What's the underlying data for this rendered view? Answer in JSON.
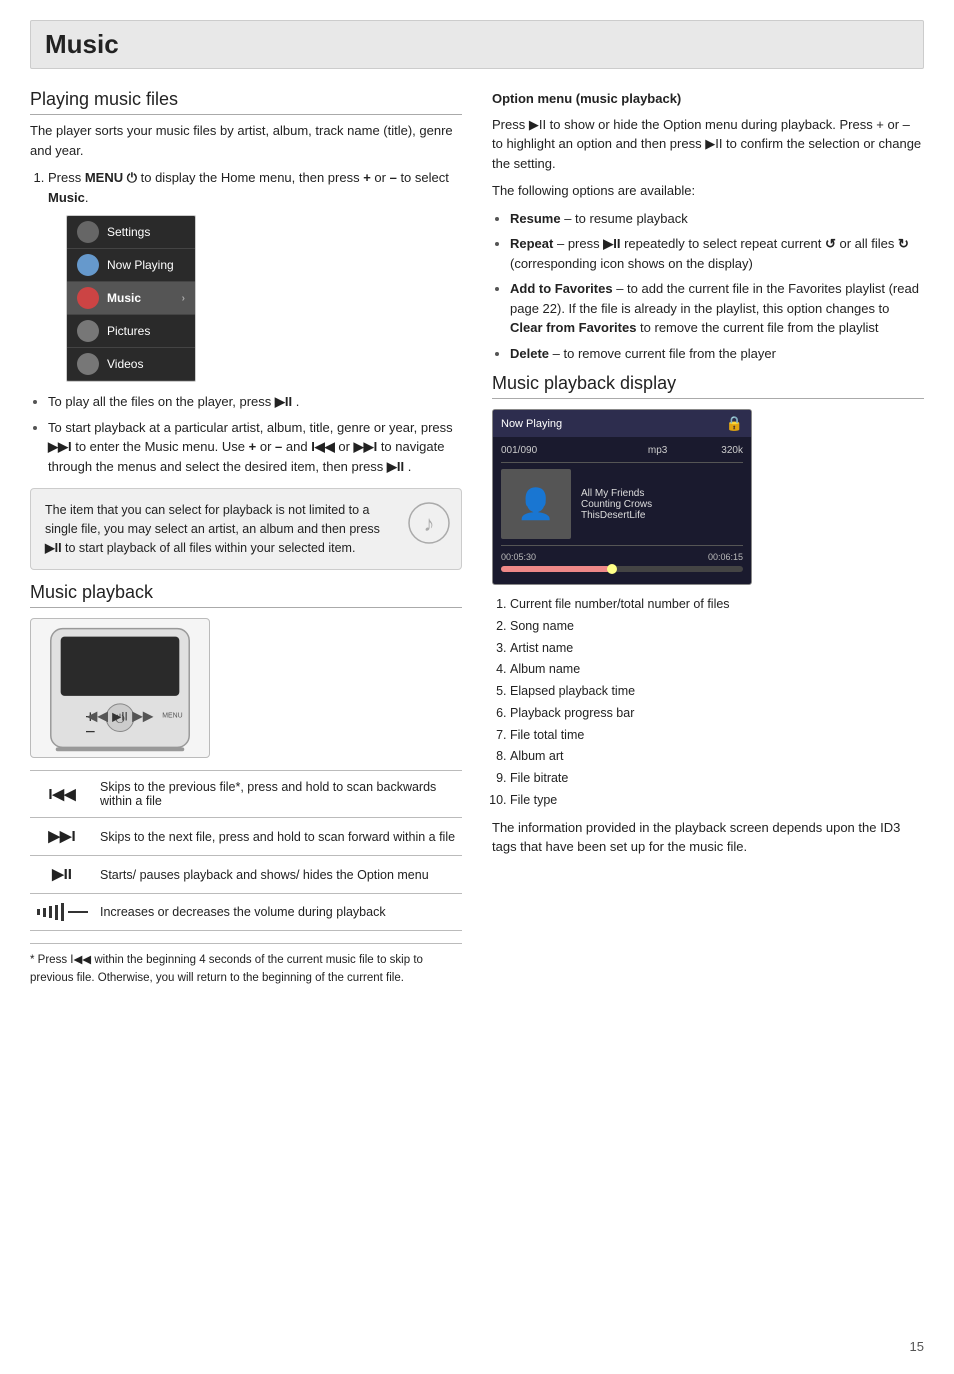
{
  "header": {
    "title": "Music"
  },
  "left_col": {
    "playing_files": {
      "title": "Playing music files",
      "intro": "The player sorts your music files by artist, album, track name (title), genre and year.",
      "step1_text": "Press ",
      "step1_menu": "MENU",
      "step1_rest": " to display the Home menu, then press + or – to select ",
      "step1_bold": "Music",
      "step1_period": ".",
      "menu_items": [
        {
          "label": "Settings",
          "type": "settings"
        },
        {
          "label": "Now Playing",
          "type": "nowplaying"
        },
        {
          "label": "Music",
          "type": "music",
          "arrow": true
        },
        {
          "label": "Pictures",
          "type": "pictures"
        },
        {
          "label": "Videos",
          "type": "videos"
        }
      ],
      "bullet1": "To play all the files on the player, press ▶II .",
      "bullet2": "To start playback at a particular artist, album, title, genre or year, press ▶▶I to enter the Music menu. Use + or – and I◀◀ or ▶▶I to navigate through the menus and select the desired item, then press ▶II .",
      "info_box": "The item that you can select for playback is not limited to a single file, you may select an artist, an album and then press ▶II to start playback of all files within your selected item."
    },
    "music_playback": {
      "title": "Music playback"
    },
    "controls": [
      {
        "symbol": "I◀◀",
        "description": "Skips to the previous file*, press and hold to scan backwards within a file"
      },
      {
        "symbol": "▶▶I",
        "description": "Skips to the next file, press and hold to scan forward within a file"
      },
      {
        "symbol": "▶II",
        "description": "Starts/ pauses playback and shows/ hides the Option menu"
      },
      {
        "symbol": "VOL",
        "description": "Increases or decreases the volume during playback"
      }
    ],
    "footnote": "* Press I◀◀ within the beginning 4 seconds of the current music file to skip to previous file. Otherwise, you will return to the beginning of the current file."
  },
  "right_col": {
    "option_menu": {
      "title": "Option menu (music playback)",
      "intro": "Press ▶II to show or hide the Option menu during playback. Press + or – to highlight an option and then press ▶II to confirm the selection or change the setting.",
      "available_label": "The following options are available:",
      "options": [
        {
          "name": "Resume",
          "desc": "– to resume playback"
        },
        {
          "name": "Repeat",
          "desc": "– press ▶II repeatedly to select repeat current",
          "extra": "or all files",
          "extra2": "(corresponding icon shows on the display)"
        },
        {
          "name": "Add to Favorites",
          "desc": "– to add the current file in the Favorites playlist (read page 22). If the file is already in the playlist, this option changes to",
          "bold2": "Clear from Favorites",
          "desc2": "to remove the current file from the playlist"
        },
        {
          "name": "Delete",
          "desc": "– to remove current file from the player"
        }
      ]
    },
    "playback_display": {
      "title": "Music playback display",
      "now_playing": "Now Playing",
      "track_num": "001/090",
      "format": "mp3",
      "bitrate": "320k",
      "song": "All My Friends",
      "artist": "Counting Crows",
      "album": "ThisDesertLife",
      "elapsed": "00:05:30",
      "total": "00:06:15",
      "progress_pct": 45
    },
    "display_items": [
      "Current file number/total number of files",
      "Song name",
      "Artist name",
      "Album name",
      "Elapsed playback time",
      "Playback progress bar",
      "File total time",
      "Album art",
      "File bitrate",
      "File type"
    ],
    "display_note": "The information provided in the playback screen depends upon the ID3 tags that have been set up for the music file."
  },
  "page_number": "15"
}
